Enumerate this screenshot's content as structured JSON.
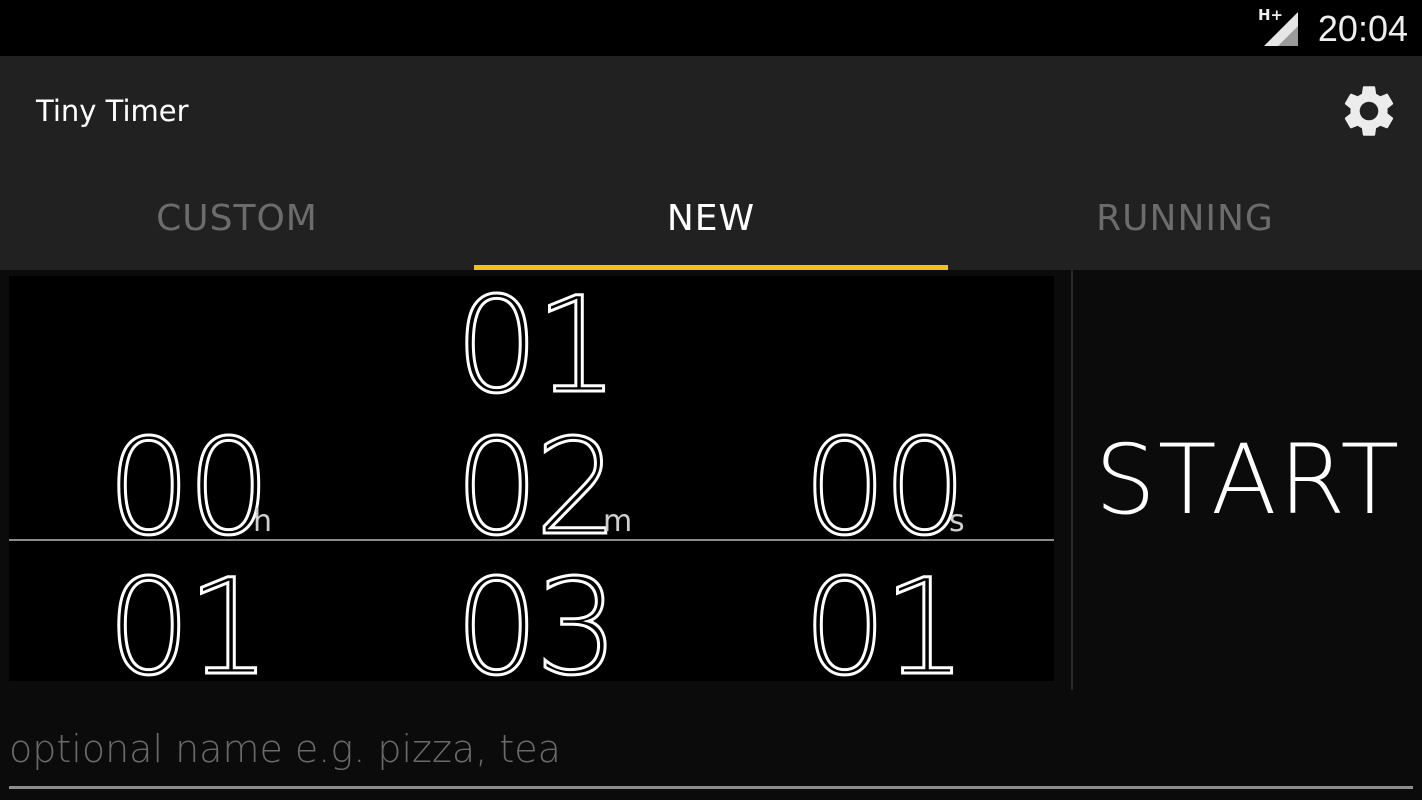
{
  "status_bar": {
    "network": "H+",
    "time": "20:04"
  },
  "app_bar": {
    "title": "Tiny Timer",
    "settings_icon": "gear-icon"
  },
  "tabs": [
    {
      "label": "CUSTOM",
      "active": false
    },
    {
      "label": "NEW",
      "active": true
    },
    {
      "label": "RUNNING",
      "active": false
    }
  ],
  "picker": {
    "hours": {
      "above": "",
      "selected": "00",
      "below": "01",
      "unit": "h"
    },
    "minutes": {
      "above": "01",
      "selected": "02",
      "below": "03",
      "unit": "m"
    },
    "seconds": {
      "above": "",
      "selected": "00",
      "below": "01",
      "unit": "s"
    }
  },
  "start_label": "START",
  "name_input": {
    "value": "",
    "placeholder": "optional name e.g. pizza, tea"
  },
  "colors": {
    "accent": "#f3c019",
    "bar": "#212121",
    "background": "#0b0b0b"
  }
}
